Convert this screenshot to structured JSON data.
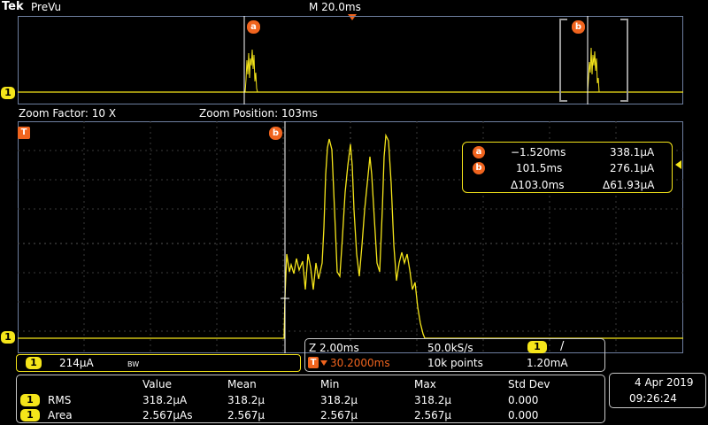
{
  "header": {
    "brand": "Tek",
    "mode": "PreVu",
    "timebase": "M 20.0ms"
  },
  "zoom": {
    "factor_label": "Zoom Factor: 10 X",
    "position_label": "Zoom Position: 103ms"
  },
  "markers": {
    "cursor_a": "a",
    "cursor_b": "b",
    "channel": "1",
    "trigger": "T"
  },
  "cursor_readout": {
    "a_time": "−1.520ms",
    "a_value": "338.1µA",
    "b_time": "101.5ms",
    "b_value": "276.1µA",
    "delta_time": "Δ103.0ms",
    "delta_value": "Δ61.93µA"
  },
  "channel_settings": {
    "scale": "214µA",
    "bw_flag": "BW"
  },
  "acquisition": {
    "zoom_scale": "Z 2.00ms",
    "sample_rate": "50.0kS/s",
    "trigger_slope": "/",
    "trigger_position": "30.2000ms",
    "record_length": "10k points",
    "trigger_level": "1.20mA"
  },
  "measurements": {
    "headers": [
      "Value",
      "Mean",
      "Min",
      "Max",
      "Std Dev"
    ],
    "rows": [
      {
        "name": "RMS",
        "cells": [
          "318.2µA",
          "318.2µ",
          "318.2µ",
          "318.2µ",
          "0.000"
        ]
      },
      {
        "name": "Area",
        "cells": [
          "2.567µAs",
          "2.567µ",
          "2.567µ",
          "2.567µ",
          "0.000"
        ]
      }
    ]
  },
  "datetime": {
    "date": "4 Apr  2019",
    "time": "09:26:24"
  },
  "colors": {
    "trace": "#f5e51a",
    "accent": "#f0641e",
    "grid": "#3a3a3a",
    "frame": "#6e7fa0"
  }
}
